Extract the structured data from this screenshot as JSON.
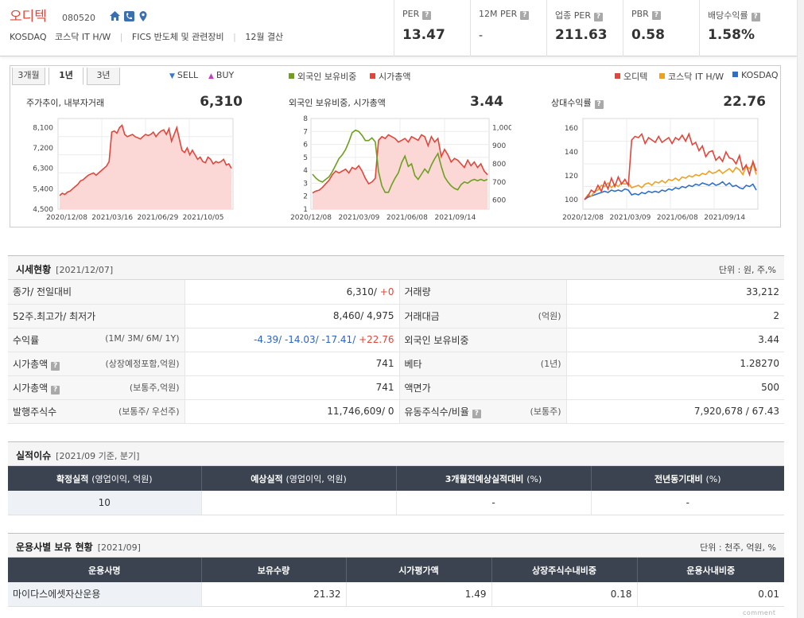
{
  "company": {
    "name": "오디텍",
    "code": "080520",
    "market": "KOSDAQ",
    "sector": "코스닥 IT H/W",
    "fics": "FICS 반도체 및 관련장비",
    "fiscal": "12월 결산"
  },
  "metrics": [
    {
      "label": "PER",
      "value": "13.47"
    },
    {
      "label": "12M PER",
      "value": "-"
    },
    {
      "label": "업종 PER",
      "value": "211.63"
    },
    {
      "label": "PBR",
      "value": "0.58"
    },
    {
      "label": "배당수익률",
      "value": "1.58%"
    }
  ],
  "chart_tabs": [
    {
      "label": "3개월",
      "active": false
    },
    {
      "label": "1년",
      "active": true
    },
    {
      "label": "3년",
      "active": false
    }
  ],
  "legends": {
    "sell": "SELL",
    "buy": "BUY",
    "foreign": "외국인 보유비중",
    "mcap": "시가총액",
    "company": "오디텍",
    "sector": "코스닥 IT H/W",
    "kosdaq": "KOSDAQ"
  },
  "colors": {
    "brand_red": "#e0463b",
    "green": "#6ca01e",
    "orange": "#f0a020",
    "blue": "#2f6fcc",
    "sell": "#3a78c8",
    "buy": "#c040c0",
    "table_header": "#3b4350"
  },
  "chart_data": [
    {
      "type": "area",
      "title": "주가추이, 내부자거래",
      "current_value": "6,310",
      "x_ticks": [
        "2020/12/08",
        "2021/03/16",
        "2021/06/29",
        "2021/10/05"
      ],
      "y_ticks": [
        "8,100",
        "7,200",
        "6,300",
        "5,400",
        "4,500"
      ],
      "ylim": [
        4500,
        8500
      ],
      "series": [
        {
          "values": [
            5100,
            5200,
            5150,
            5250,
            5300,
            5400,
            5500,
            5600,
            5750,
            5800,
            5900,
            6000,
            6050,
            6100,
            6000,
            6100,
            6200,
            6300,
            6400,
            6600,
            7900,
            7950,
            7850,
            8100,
            8200,
            7800,
            7700,
            7750,
            7800,
            7700,
            7650,
            7600,
            7700,
            7800,
            7750,
            7800,
            7900,
            7700,
            7850,
            7950,
            8000,
            7800,
            8050,
            7500,
            7800,
            8100,
            7600,
            7100,
            7000,
            7200,
            6900,
            7100,
            6900,
            6700,
            6800,
            6600,
            6550,
            6800,
            6700,
            6500,
            6600,
            6550,
            6600,
            6700,
            6450,
            6500,
            6300
          ]
        }
      ]
    },
    {
      "type": "line",
      "title": "외국인 보유비중, 시가총액",
      "current_value": "3.44",
      "x_ticks": [
        "2020/12/08",
        "2021/03/09",
        "2021/06/08",
        "2021/09/14"
      ],
      "y_ticks_left": [
        "8",
        "7",
        "6",
        "5",
        "4",
        "3",
        "2",
        "1"
      ],
      "y_ticks_right": [
        "1,000",
        "900",
        "800",
        "700",
        "600"
      ],
      "ylim_left": [
        1,
        8
      ],
      "ylim_right": [
        550,
        1050
      ],
      "series": [
        {
          "name": "외국인 보유비중",
          "axis": "left",
          "values": [
            3.7,
            3.4,
            3.2,
            3.1,
            3.3,
            3.5,
            3.9,
            4.4,
            4.9,
            5.2,
            5.6,
            6.2,
            6.9,
            7.1,
            7.0,
            6.7,
            6.3,
            6.3,
            6.5,
            6.2,
            3.9,
            2.8,
            2.3,
            2.3,
            2.9,
            3.4,
            3.8,
            4.6,
            5.1,
            4.3,
            4.5,
            3.6,
            3.3,
            3.7,
            4.1,
            3.8,
            4.4,
            4.9,
            5.3,
            4.3,
            3.5,
            3.1,
            2.8,
            2.6,
            2.5,
            2.9,
            3.1,
            3.0,
            3.2,
            3.3,
            3.2,
            3.3,
            3.2,
            3.3
          ]
        },
        {
          "name": "시가총액",
          "axis": "right",
          "values": [
            640,
            650,
            655,
            670,
            690,
            710,
            740,
            760,
            750,
            760,
            770,
            750,
            780,
            770,
            790,
            760,
            720,
            690,
            700,
            720,
            930,
            950,
            940,
            960,
            950,
            940,
            920,
            930,
            940,
            920,
            950,
            940,
            930,
            960,
            950,
            900,
            950,
            920,
            940,
            840,
            880,
            850,
            810,
            830,
            820,
            800,
            780,
            820,
            790,
            810,
            780,
            800,
            760,
            740
          ]
        }
      ]
    },
    {
      "type": "line",
      "title": "상대수익률",
      "current_value": "22.76",
      "x_ticks": [
        "2020/12/08",
        "2021/03/09",
        "2021/06/08",
        "2021/09/14"
      ],
      "y_ticks": [
        "160",
        "140",
        "120",
        "100"
      ],
      "ylim": [
        92,
        168
      ],
      "series": [
        {
          "name": "오디텍",
          "values": [
            100,
            103,
            108,
            106,
            112,
            107,
            115,
            109,
            118,
            111,
            119,
            113,
            117,
            112,
            150,
            153,
            152,
            155,
            147,
            152,
            150,
            148,
            153,
            148,
            150,
            152,
            147,
            152,
            150,
            154,
            149,
            155,
            146,
            148,
            141,
            145,
            136,
            140,
            141,
            133,
            136,
            132,
            140,
            135,
            134,
            130,
            137,
            125,
            129,
            121,
            132,
            124
          ]
        },
        {
          "name": "코스닥 IT H/W",
          "values": [
            100,
            104,
            103,
            107,
            108,
            112,
            111,
            114,
            110,
            113,
            111,
            114,
            113,
            114,
            110,
            111,
            112,
            110,
            113,
            114,
            112,
            115,
            114,
            116,
            114,
            117,
            116,
            118,
            116,
            119,
            118,
            120,
            119,
            121,
            120,
            122,
            121,
            124,
            122,
            123,
            125,
            122,
            124,
            126,
            123,
            127,
            125,
            121,
            128,
            126,
            130,
            121
          ]
        },
        {
          "name": "KOSDAQ",
          "values": [
            100,
            102,
            103,
            104,
            105,
            106,
            107,
            106,
            108,
            107,
            108,
            107,
            109,
            108,
            104,
            105,
            104,
            106,
            105,
            107,
            106,
            107,
            106,
            108,
            107,
            109,
            108,
            110,
            109,
            111,
            110,
            112,
            111,
            113,
            112,
            114,
            113,
            112,
            114,
            112,
            113,
            115,
            112,
            114,
            111,
            112,
            110,
            109,
            112,
            111,
            113,
            108
          ]
        }
      ]
    }
  ],
  "price_section": {
    "title": "시세현황",
    "date": "[2021/12/07]",
    "unit": "단위 : 원, 주,%",
    "rows": [
      {
        "l1": "종가/ 전일대비",
        "s1": "",
        "v1": "6,310/",
        "v1b": "+0",
        "l2": "거래량",
        "s2": "",
        "v2": "33,212"
      },
      {
        "l1": "52주.최고가/ 최저가",
        "s1": "",
        "v1": "8,460/ 4,975",
        "v1b": "",
        "l2": "거래대금",
        "s2": "(억원)",
        "v2": "2"
      },
      {
        "l1": "수익률",
        "s1": "(1M/ 3M/ 6M/ 1Y)",
        "v1": "-4.39/ -14.03/ -17.41/",
        "v1b": "+22.76",
        "l2": "외국인 보유비중",
        "s2": "",
        "v2": "3.44"
      },
      {
        "l1": "시가총액",
        "s1": "(상장예정포함,억원)",
        "v1": "741",
        "v1b": "",
        "l2": "베타",
        "s2": "(1년)",
        "v2": "1.28270"
      },
      {
        "l1": "시가총액",
        "s1": "(보통주,억원)",
        "v1": "741",
        "v1b": "",
        "l2": "액면가",
        "s2": "",
        "v2": "500"
      },
      {
        "l1": "발행주식수",
        "s1": "(보통주/ 우선주)",
        "v1": "11,746,609/ 0",
        "v1b": "",
        "l2": "유동주식수/비율",
        "s2": "(보통주)",
        "v2": "7,920,678 / 67.43"
      }
    ]
  },
  "perf_section": {
    "title": "실적이슈",
    "date": "[2021/09 기준, 분기]",
    "headers": [
      {
        "main": "확정실적",
        "sub": "(영업이익, 억원)"
      },
      {
        "main": "예상실적",
        "sub": "(영업이익, 억원)"
      },
      {
        "main": "3개월전예상실적대비",
        "sub": "(%)"
      },
      {
        "main": "전년동기대비",
        "sub": "(%)"
      }
    ],
    "row": [
      "10",
      "",
      "-",
      "-"
    ]
  },
  "fund_section": {
    "title": "운용사별 보유 현황",
    "date": "[2021/09]",
    "unit": "단위 : 천주, 억원, %",
    "headers": [
      "운용사명",
      "보유수량",
      "시가평가액",
      "상장주식수내비중",
      "운용사내비중"
    ],
    "row": [
      "마이다스에셋자산운용",
      "21.32",
      "1.49",
      "0.18",
      "0.01"
    ]
  },
  "footnote": "comment"
}
